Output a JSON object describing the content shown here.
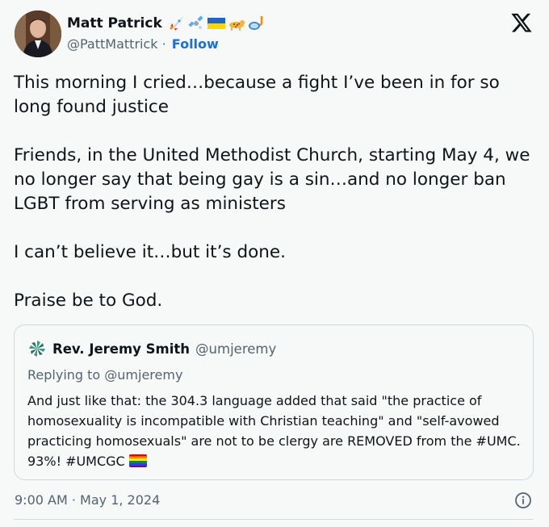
{
  "author": {
    "display_name": "Matt Patrick",
    "handle": "@PattMattrick",
    "separator": " · ",
    "follow_label": "Follow",
    "emoji_icons": [
      "rocket-emoji",
      "satellite-emoji",
      "ukraine-flag-emoji",
      "leopard-emoji",
      "diving-mask-emoji"
    ]
  },
  "tweet": {
    "paragraphs": [
      "This morning I cried…because a fight I’ve been in for so long found justice",
      "Friends, in the United Methodist Church, starting May 4, we no longer say that being gay is a sin…and no longer ban LGBT from serving as ministers",
      "I can’t believe it…but it’s done.",
      "Praise be to God."
    ]
  },
  "quote": {
    "display_name": "Rev. Jeremy Smith",
    "handle": "@umjeremy",
    "replying_to": "Replying to @umjeremy",
    "body": "And just like that: the 304.3 language added that said \"the practice of homosexuality is incompatible with Christian teaching\" and \"self-avowed practicing homosexuals\" are not to be clergy are REMOVED from the #UMC. 93%! #UMCGC",
    "trailing_icon": "rainbow-flag-emoji"
  },
  "footer": {
    "timestamp": "9:00 AM · May 1, 2024"
  },
  "colors": {
    "background": "#f7f8f8",
    "text": "#0f1419",
    "secondary": "#536471",
    "link": "#1d6fd4",
    "border": "#cfd9de"
  }
}
